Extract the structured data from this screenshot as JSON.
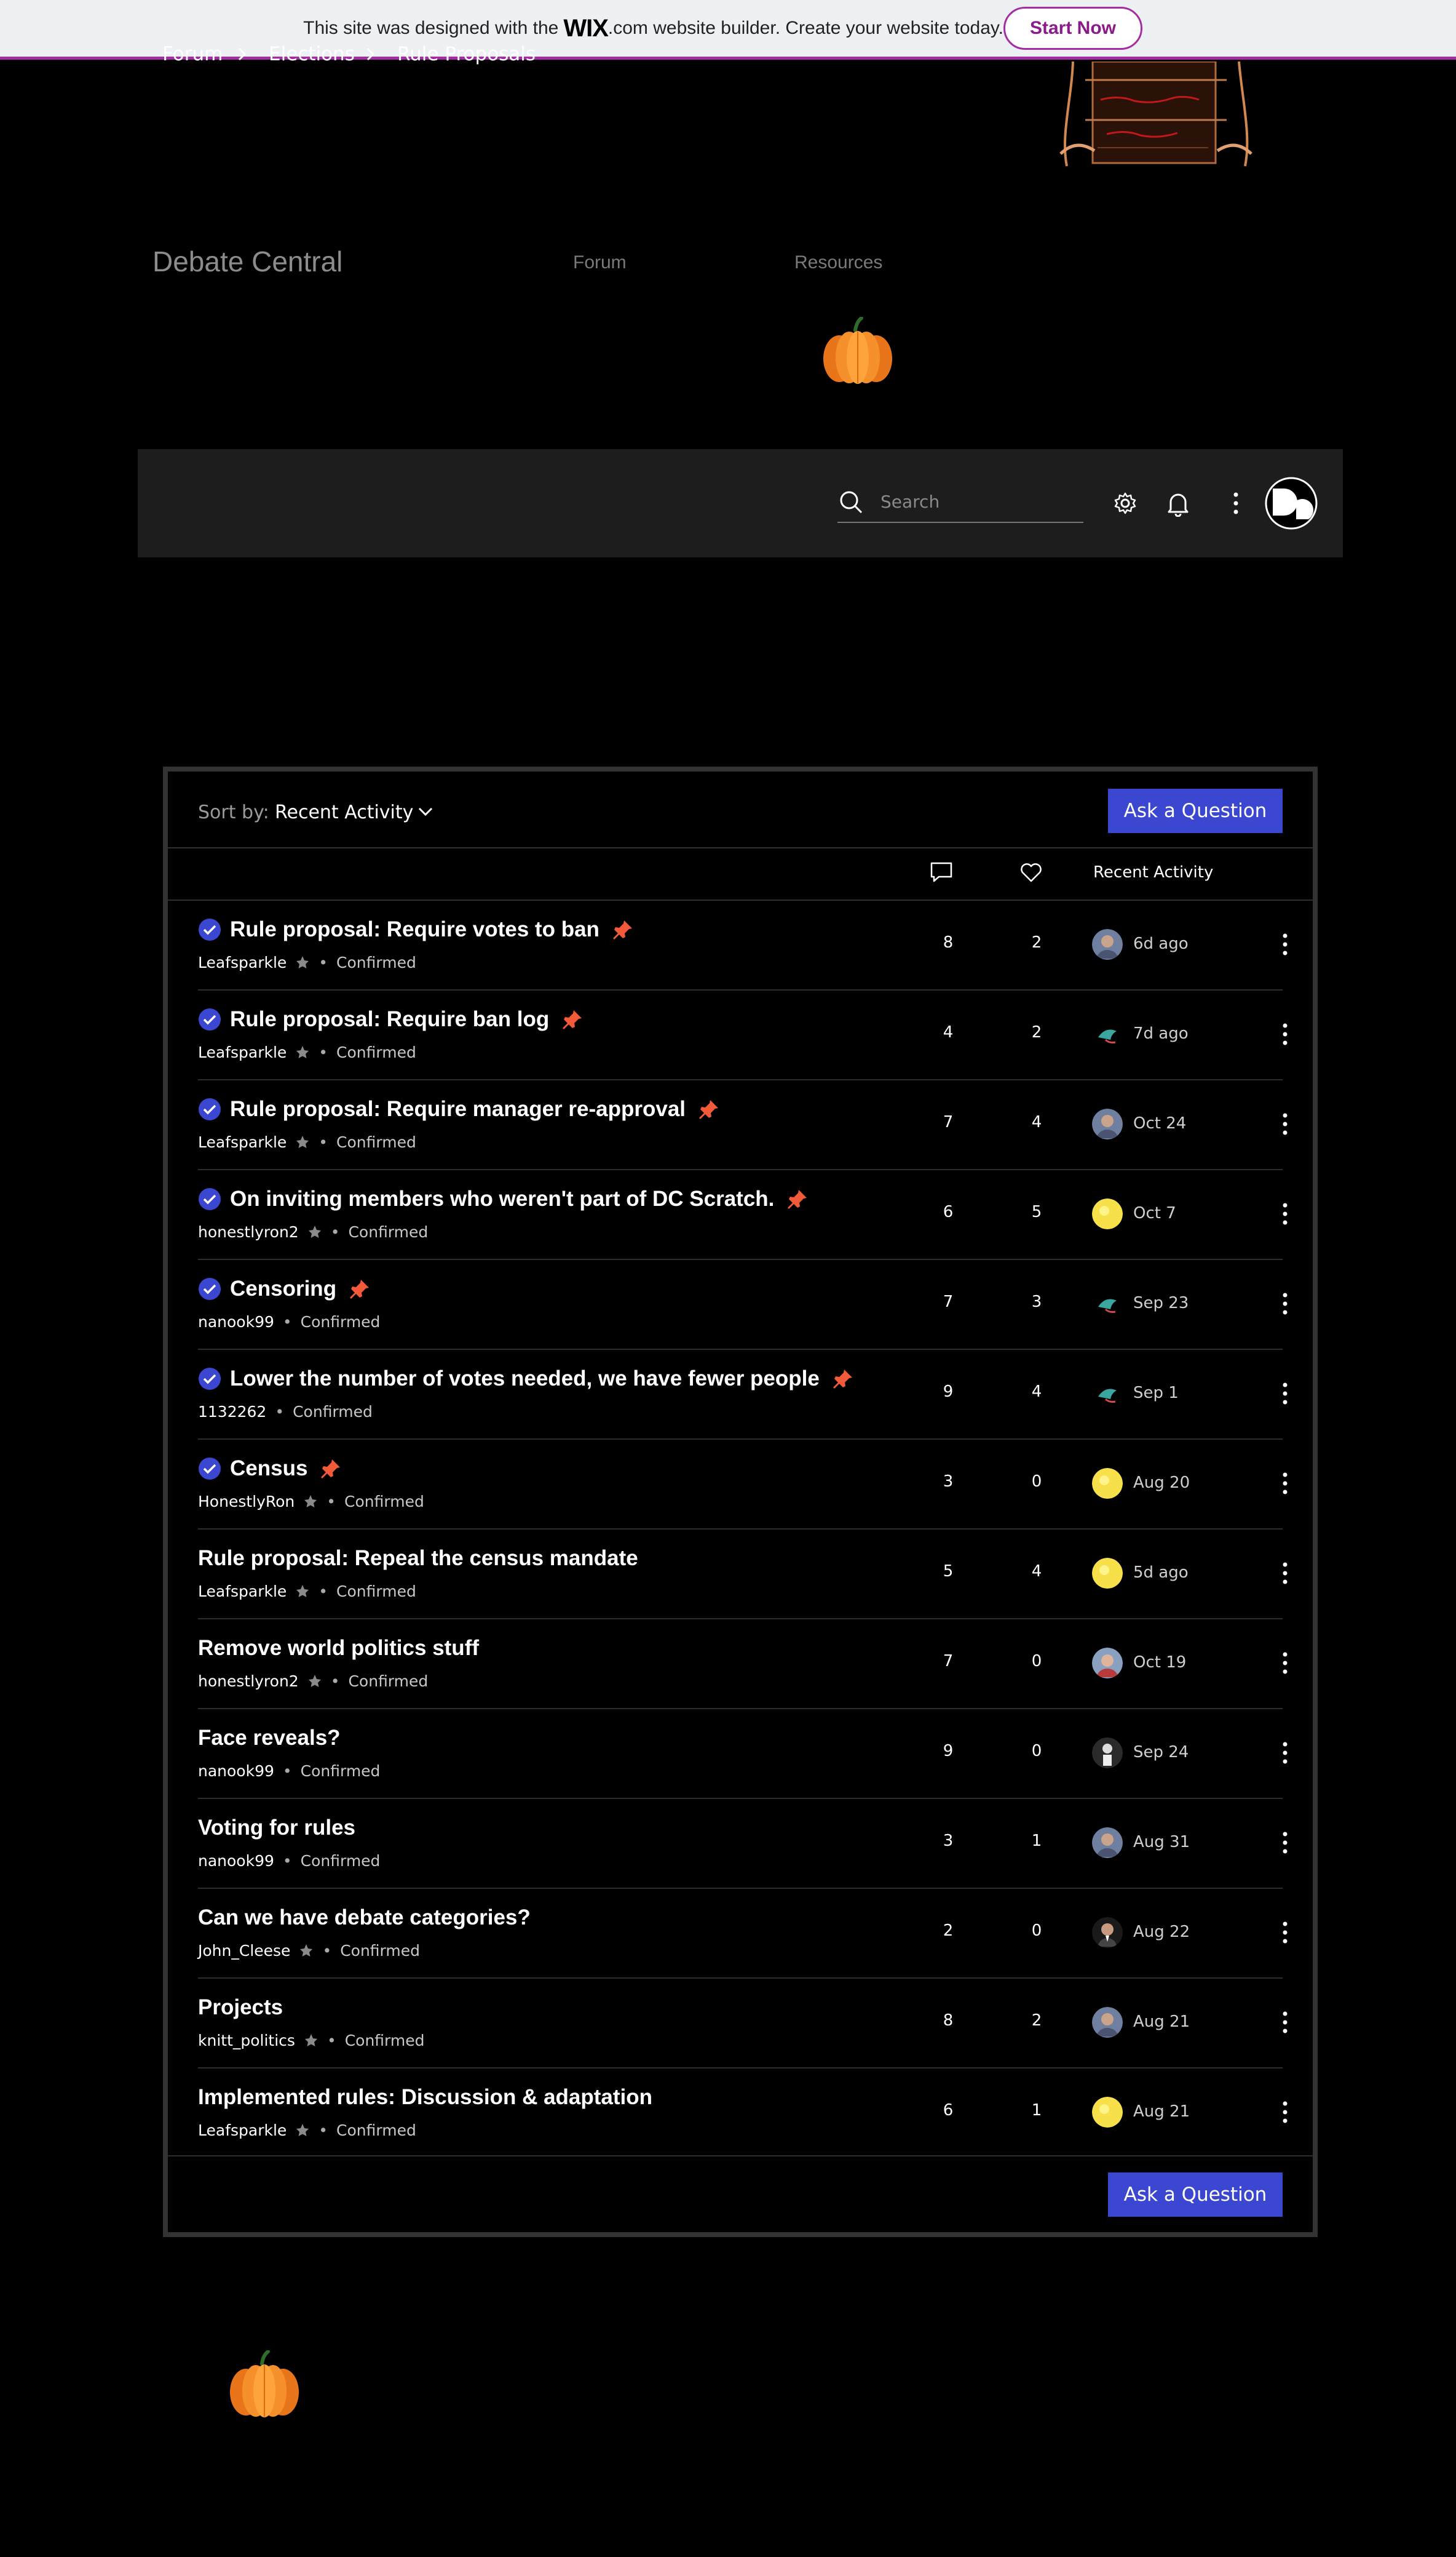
{
  "wix_banner": {
    "text_before": "This site was designed with the",
    "logo": "WIX",
    "text_after": ".com website builder. Create your website today.",
    "cta": "Start Now"
  },
  "site": {
    "title": "Debate Central",
    "nav": [
      "Forum",
      "Resources"
    ]
  },
  "forum_bar": {
    "breadcrumb": [
      "Forum",
      "Elections",
      "Rule Proposals"
    ],
    "search_placeholder": "Search",
    "icons": [
      "search-icon",
      "gear-icon",
      "bell-icon",
      "more-icon",
      "avatar"
    ]
  },
  "toolbar": {
    "sort_label": "Sort by:",
    "sort_value": "Recent Activity",
    "ask_label": "Ask a Question"
  },
  "columns": {
    "comments_icon": "comment-icon",
    "likes_icon": "heart-icon",
    "activity": "Recent Activity"
  },
  "colors": {
    "accent": "#3b47d1",
    "pin": "#f25a3a",
    "wix_brand": "#a42ca4"
  },
  "posts": [
    {
      "title": "Rule proposal: Require votes to ban",
      "author": "Leafsparkle",
      "badge": true,
      "status": "Confirmed",
      "comments": "8",
      "likes": "2",
      "date": "6d ago",
      "verified": true,
      "pinned": true,
      "avatar": "gray"
    },
    {
      "title": "Rule proposal: Require ban log",
      "author": "Leafsparkle",
      "badge": true,
      "status": "Confirmed",
      "comments": "4",
      "likes": "2",
      "date": "7d ago",
      "verified": true,
      "pinned": true,
      "avatar": "bird"
    },
    {
      "title": "Rule proposal: Require manager re-approval",
      "author": "Leafsparkle",
      "badge": true,
      "status": "Confirmed",
      "comments": "7",
      "likes": "4",
      "date": "Oct 24",
      "verified": true,
      "pinned": true,
      "avatar": "gray"
    },
    {
      "title": "On inviting members who weren't part of DC Scratch.",
      "author": "honestlyron2",
      "badge": true,
      "status": "Confirmed",
      "comments": "6",
      "likes": "5",
      "date": "Oct 7",
      "verified": true,
      "pinned": true,
      "avatar": "yellow"
    },
    {
      "title": "Censoring",
      "author": "nanook99",
      "badge": false,
      "status": "Confirmed",
      "comments": "7",
      "likes": "3",
      "date": "Sep 23",
      "verified": true,
      "pinned": true,
      "avatar": "bird"
    },
    {
      "title": "Lower the number of votes needed, we have fewer people",
      "author": "1132262",
      "badge": false,
      "status": "Confirmed",
      "comments": "9",
      "likes": "4",
      "date": "Sep 1",
      "verified": true,
      "pinned": true,
      "avatar": "bird"
    },
    {
      "title": "Census",
      "author": "HonestlyRon",
      "badge": true,
      "status": "Confirmed",
      "comments": "3",
      "likes": "0",
      "date": "Aug 20",
      "verified": true,
      "pinned": true,
      "avatar": "yellow"
    },
    {
      "title": "Rule proposal: Repeal the census mandate",
      "author": "Leafsparkle",
      "badge": true,
      "status": "Confirmed",
      "comments": "5",
      "likes": "4",
      "date": "5d ago",
      "verified": false,
      "pinned": false,
      "avatar": "yellow"
    },
    {
      "title": "Remove world politics stuff",
      "author": "honestlyron2",
      "badge": true,
      "status": "Confirmed",
      "comments": "7",
      "likes": "0",
      "date": "Oct 19",
      "verified": false,
      "pinned": false,
      "avatar": "photo"
    },
    {
      "title": "Face reveals?",
      "author": "nanook99",
      "badge": false,
      "status": "Confirmed",
      "comments": "9",
      "likes": "0",
      "date": "Sep 24",
      "verified": false,
      "pinned": false,
      "avatar": "dark"
    },
    {
      "title": "Voting for rules",
      "author": "nanook99",
      "badge": false,
      "status": "Confirmed",
      "comments": "3",
      "likes": "1",
      "date": "Aug 31",
      "verified": false,
      "pinned": false,
      "avatar": "gray"
    },
    {
      "title": "Can we have debate categories?",
      "author": "John_Cleese",
      "badge": true,
      "status": "Confirmed",
      "comments": "2",
      "likes": "0",
      "date": "Aug 22",
      "verified": false,
      "pinned": false,
      "avatar": "man"
    },
    {
      "title": "Projects",
      "author": "knitt_politics",
      "badge": true,
      "status": "Confirmed",
      "comments": "8",
      "likes": "2",
      "date": "Aug 21",
      "verified": false,
      "pinned": false,
      "avatar": "gray"
    },
    {
      "title": "Implemented rules: Discussion & adaptation",
      "author": "Leafsparkle",
      "badge": true,
      "status": "Confirmed",
      "comments": "6",
      "likes": "1",
      "date": "Aug 21",
      "verified": false,
      "pinned": false,
      "avatar": "yellow"
    }
  ]
}
